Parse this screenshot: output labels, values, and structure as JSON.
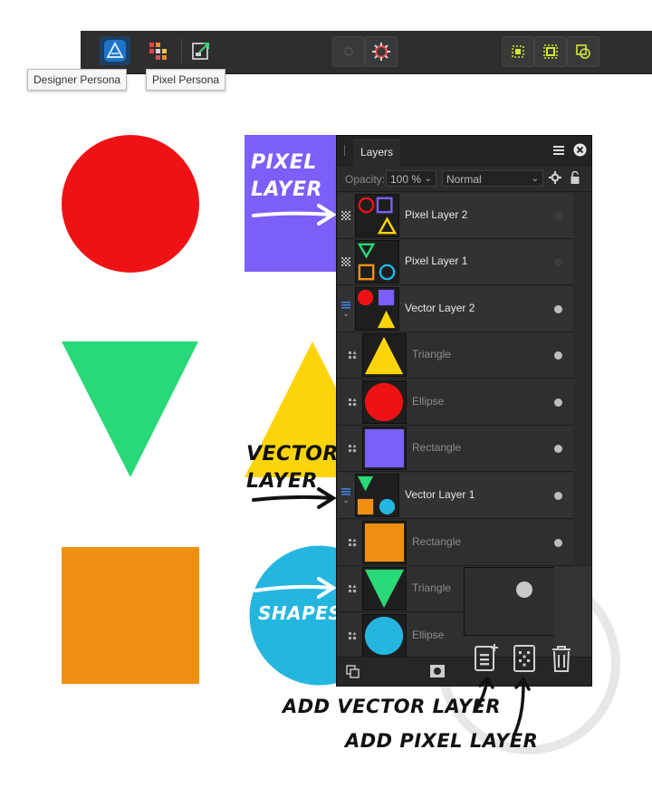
{
  "toolbar": {
    "tooltip_designer": "Designer Persona",
    "tooltip_pixel": "Pixel Persona"
  },
  "icons": {
    "designer": "designer-persona-icon",
    "pixel": "pixel-persona-icon",
    "export": "export-persona-icon",
    "snap_circle": "snapping-off-icon",
    "snap_gear": "snapping-settings-icon",
    "align1": "selection-box-icon",
    "align2": "selection-bounds-icon",
    "align3": "geometry-icon"
  },
  "annotations": {
    "pixel_layer": [
      "PIXEL",
      "LAYER"
    ],
    "vector_layer": [
      "VECTOR",
      "LAYER"
    ],
    "shapes": "SHAPES",
    "add_vector_layer": "ADD VECTOR LAYER",
    "add_pixel_layer": "ADD PIXEL LAYER"
  },
  "layers_panel": {
    "tab_label": "Layers",
    "opacity_label": "Opacity:",
    "opacity_value": "100 %",
    "blend_mode": "Normal",
    "rows": [
      {
        "name": "Pixel Layer 2",
        "type": "pixel",
        "child": false,
        "active": true
      },
      {
        "name": "Pixel Layer 1",
        "type": "pixel",
        "child": false,
        "active": true
      },
      {
        "name": "Vector Layer 2",
        "type": "group",
        "child": false,
        "active": true
      },
      {
        "name": "Triangle",
        "type": "shape",
        "child": true,
        "active": false
      },
      {
        "name": "Ellipse",
        "type": "shape",
        "child": true,
        "active": false
      },
      {
        "name": "Rectangle",
        "type": "shape",
        "child": true,
        "active": false
      },
      {
        "name": "Vector Layer 1",
        "type": "group",
        "child": false,
        "active": true
      },
      {
        "name": "Rectangle",
        "type": "shape",
        "child": true,
        "active": false
      },
      {
        "name": "Triangle",
        "type": "shape",
        "child": true,
        "active": false
      },
      {
        "name": "Ellipse",
        "type": "shape",
        "child": true,
        "active": false
      }
    ]
  },
  "colors": {
    "red": "#ef1215",
    "green": "#29d876",
    "orange": "#f18f13",
    "purple": "#7c5ef9",
    "yellow": "#fbd50a",
    "cyan": "#25b6e0"
  }
}
